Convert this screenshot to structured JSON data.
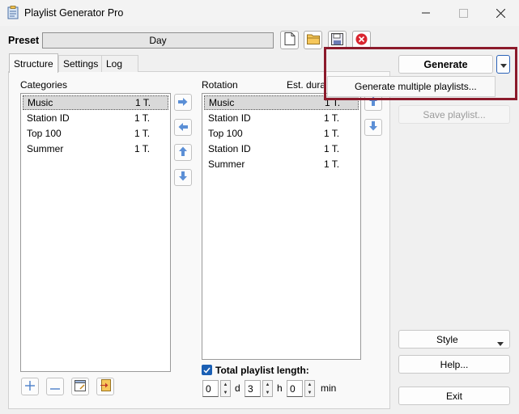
{
  "window": {
    "title": "Playlist Generator Pro",
    "controls": [
      "minimize",
      "maximize",
      "close"
    ]
  },
  "preset": {
    "label": "Preset",
    "value": "Day",
    "tools": [
      "new-file-icon",
      "open-folder-icon",
      "save-disk-icon",
      "delete-icon"
    ]
  },
  "tabs": [
    {
      "label": "Structure",
      "active": true
    },
    {
      "label": "Settings",
      "active": false
    },
    {
      "label": "Log",
      "active": false
    }
  ],
  "categories": {
    "header": "Categories",
    "items": [
      {
        "name": "Music",
        "duration": "1 T.",
        "selected": true
      },
      {
        "name": "Station ID",
        "duration": "1 T.",
        "selected": false
      },
      {
        "name": "Top 100",
        "duration": "1 T.",
        "selected": false
      },
      {
        "name": "Summer",
        "duration": "1 T.",
        "selected": false
      }
    ]
  },
  "rotation": {
    "header": "Rotation",
    "duration_header": "Est. dura",
    "items": [
      {
        "name": "Music",
        "duration": "1 T.",
        "selected": true
      },
      {
        "name": "Station ID",
        "duration": "1 T.",
        "selected": false
      },
      {
        "name": "Top 100",
        "duration": "1 T.",
        "selected": false
      },
      {
        "name": "Station ID",
        "duration": "1 T.",
        "selected": false
      },
      {
        "name": "Summer",
        "duration": "1 T.",
        "selected": false
      }
    ]
  },
  "total_length": {
    "label": "Total playlist length:",
    "checked": true,
    "days": "0",
    "days_unit": "d",
    "hours": "3",
    "hours_unit": "h",
    "minutes": "0",
    "minutes_unit": "min"
  },
  "actions": {
    "generate": "Generate",
    "menu_item": "Generate multiple playlists...",
    "save_playlist": "Save playlist...",
    "style": "Style",
    "help": "Help...",
    "exit": "Exit"
  },
  "colors": {
    "accent": "#1a5fb4",
    "highlight_border": "#8b1a2b",
    "selection": "#d9d9d9"
  }
}
